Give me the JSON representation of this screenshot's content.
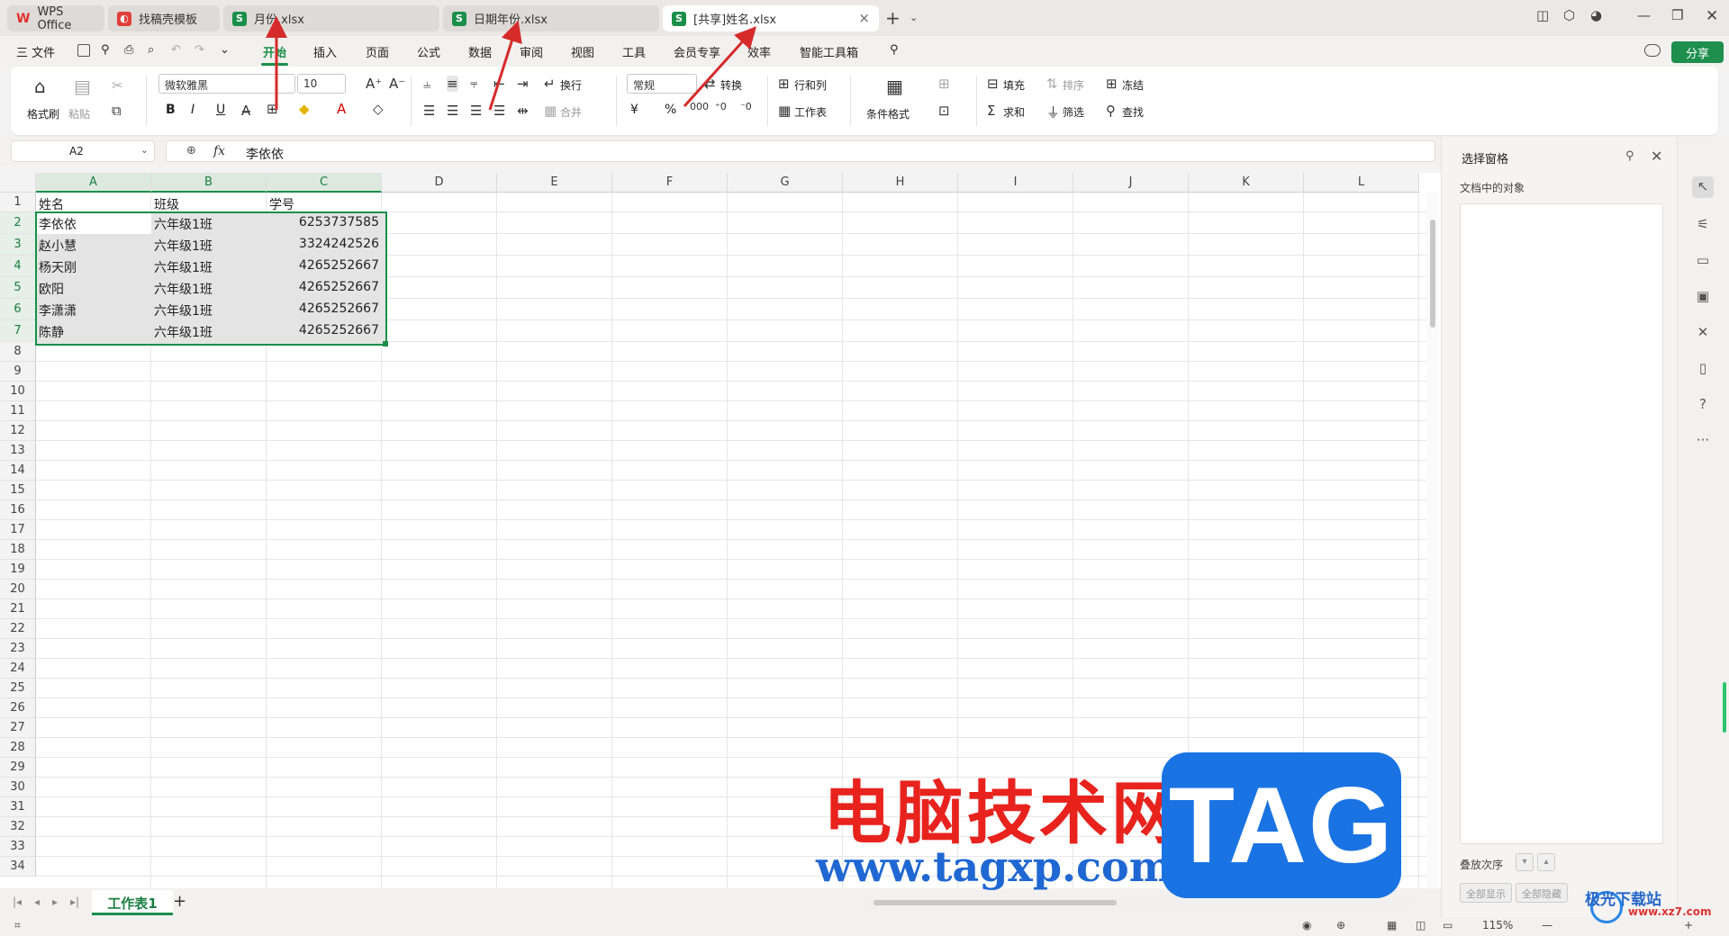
{
  "tabs": [
    {
      "label": "WPS Office",
      "icon": "wps-logo-icon"
    },
    {
      "label": "找稿壳模板",
      "icon": "template-icon"
    },
    {
      "label": "月份.xlsx",
      "icon": "sheet-icon"
    },
    {
      "label": "日期年份.xlsx",
      "icon": "sheet-icon"
    },
    {
      "label": "[共享]姓名.xlsx",
      "icon": "sheet-icon",
      "active": true
    }
  ],
  "tab_icon_glyphs": {
    "wps": "W",
    "template": "◐",
    "sheet": "S"
  },
  "menu": {
    "file": "三 文件",
    "items": [
      "开始",
      "插入",
      "页面",
      "公式",
      "数据",
      "审阅",
      "视图",
      "工具",
      "会员专享",
      "效率",
      "智能工具箱"
    ],
    "share": "分享"
  },
  "ribbon": {
    "format_painter": "格式刷",
    "paste": "粘贴",
    "font_name": "微软雅黑",
    "font_size": "10",
    "wrap": "换行",
    "merge": "合并",
    "number_format": "常规",
    "convert": "转换",
    "rows_cols": "行和列",
    "worksheet": "工作表",
    "cond_format": "条件格式",
    "fill": "填充",
    "sort": "排序",
    "freeze": "冻结",
    "sum": "求和",
    "filter": "筛选",
    "find": "查找",
    "bold": "B",
    "italic": "I",
    "underline": "U",
    "currency": "¥",
    "percent": "%"
  },
  "formula_bar": {
    "name_box": "A2",
    "fx": "fx",
    "content": "李依依"
  },
  "columns": [
    "A",
    "B",
    "C",
    "D",
    "E",
    "F",
    "G",
    "H",
    "I",
    "J",
    "K",
    "L"
  ],
  "rows": [
    "1",
    "2",
    "3",
    "4",
    "5",
    "6",
    "7",
    "8",
    "9",
    "10",
    "11",
    "12",
    "13",
    "14",
    "15",
    "16",
    "17",
    "18",
    "19",
    "20",
    "21",
    "22",
    "23",
    "24",
    "25",
    "26",
    "27",
    "28",
    "29",
    "30",
    "31",
    "32",
    "33",
    "34"
  ],
  "table": {
    "headers": [
      "姓名",
      "班级",
      "学号"
    ],
    "rows": [
      [
        "李依依",
        "六年级1班",
        "6253737585"
      ],
      [
        "赵小慧",
        "六年级1班",
        "3324242526"
      ],
      [
        "杨天刚",
        "六年级1班",
        "4265252667"
      ],
      [
        "欧阳",
        "六年级1班",
        "4265252667"
      ],
      [
        "李潇潇",
        "六年级1班",
        "4265252667"
      ],
      [
        "陈静",
        "六年级1班",
        "4265252667"
      ]
    ]
  },
  "sheet_tabs": {
    "active": "工作表1",
    "add": "+"
  },
  "selection_pane": {
    "title": "选择窗格",
    "subtitle": "文档中的对象",
    "order": "叠放次序",
    "show_all": "全部显示",
    "hide_all": "全部隐藏"
  },
  "status": {
    "zoom": "115%"
  },
  "watermark": {
    "cn": "电脑技术网",
    "url": "www.tagxp.com",
    "tag": "TAG",
    "site": "极光下载站",
    "site_url": "www.xz7.com"
  },
  "colors": {
    "accent": "#1a8f4a",
    "arrow": "#d62b2b",
    "tag_blue": "#1a73e3"
  }
}
